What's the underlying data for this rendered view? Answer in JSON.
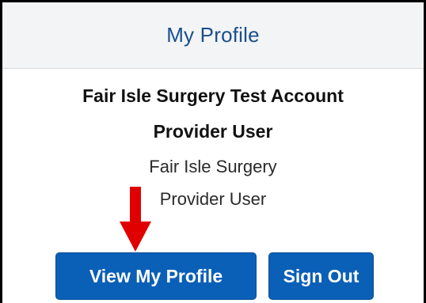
{
  "header": {
    "title": "My Profile"
  },
  "profile": {
    "account_name": "Fair Isle Surgery Test Account",
    "role": "Provider User",
    "organisation": "Fair Isle Surgery",
    "user_type": "Provider User"
  },
  "actions": {
    "view_profile_label": "View My Profile",
    "sign_out_label": "Sign Out"
  },
  "annotation": {
    "arrow_color": "#e00000",
    "arrow_icon": "down-arrow-icon"
  },
  "colors": {
    "button": "#0a5fb7",
    "header_text": "#1a4f8b"
  }
}
